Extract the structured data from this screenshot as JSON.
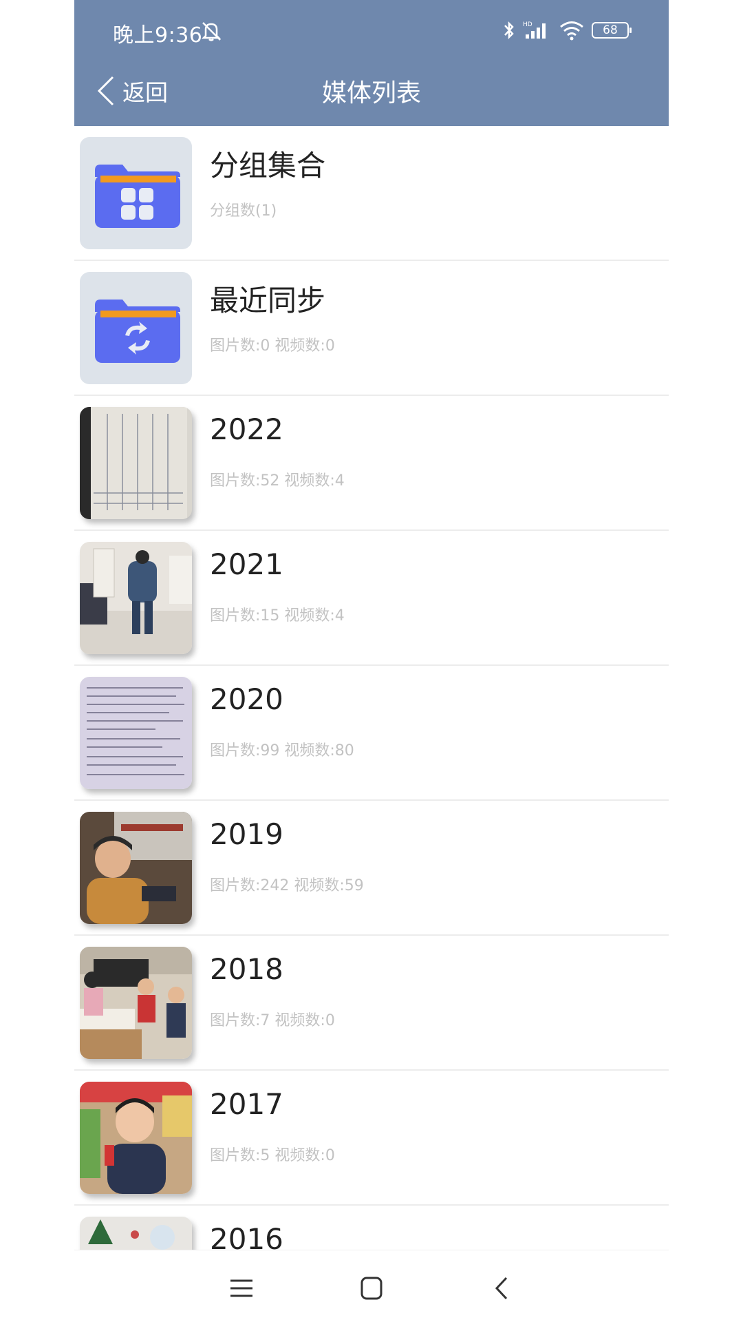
{
  "status_bar": {
    "time": "晚上9:36",
    "battery": "68",
    "icons": [
      "mute-bell-icon",
      "bluetooth-icon",
      "hd-signal-icon",
      "wifi-icon",
      "battery-icon"
    ]
  },
  "header": {
    "back_label": "返回",
    "title": "媒体列表",
    "background_color": "#6f88ad"
  },
  "items": [
    {
      "title": "分组集合",
      "subtitle": "分组数(1)",
      "thumb": "folder-grid-icon"
    },
    {
      "title": "最近同步",
      "subtitle": "图片数:0 视频数:0",
      "thumb": "folder-sync-icon"
    },
    {
      "title": "2022",
      "subtitle": "图片数:52 视频数:4",
      "thumb": "photo-notes"
    },
    {
      "title": "2021",
      "subtitle": "图片数:15 视频数:4",
      "thumb": "photo-room"
    },
    {
      "title": "2020",
      "subtitle": "图片数:99 视频数:80",
      "thumb": "photo-document"
    },
    {
      "title": "2019",
      "subtitle": "图片数:242 视频数:59",
      "thumb": "photo-child"
    },
    {
      "title": "2018",
      "subtitle": "图片数:7 视频数:0",
      "thumb": "photo-classroom"
    },
    {
      "title": "2017",
      "subtitle": "图片数:5 视频数:0",
      "thumb": "photo-boy"
    },
    {
      "title": "2016",
      "subtitle": "",
      "thumb": "photo-wall"
    }
  ],
  "system_nav": {
    "icons": [
      "menu-icon",
      "home-icon",
      "back-nav-icon"
    ]
  }
}
